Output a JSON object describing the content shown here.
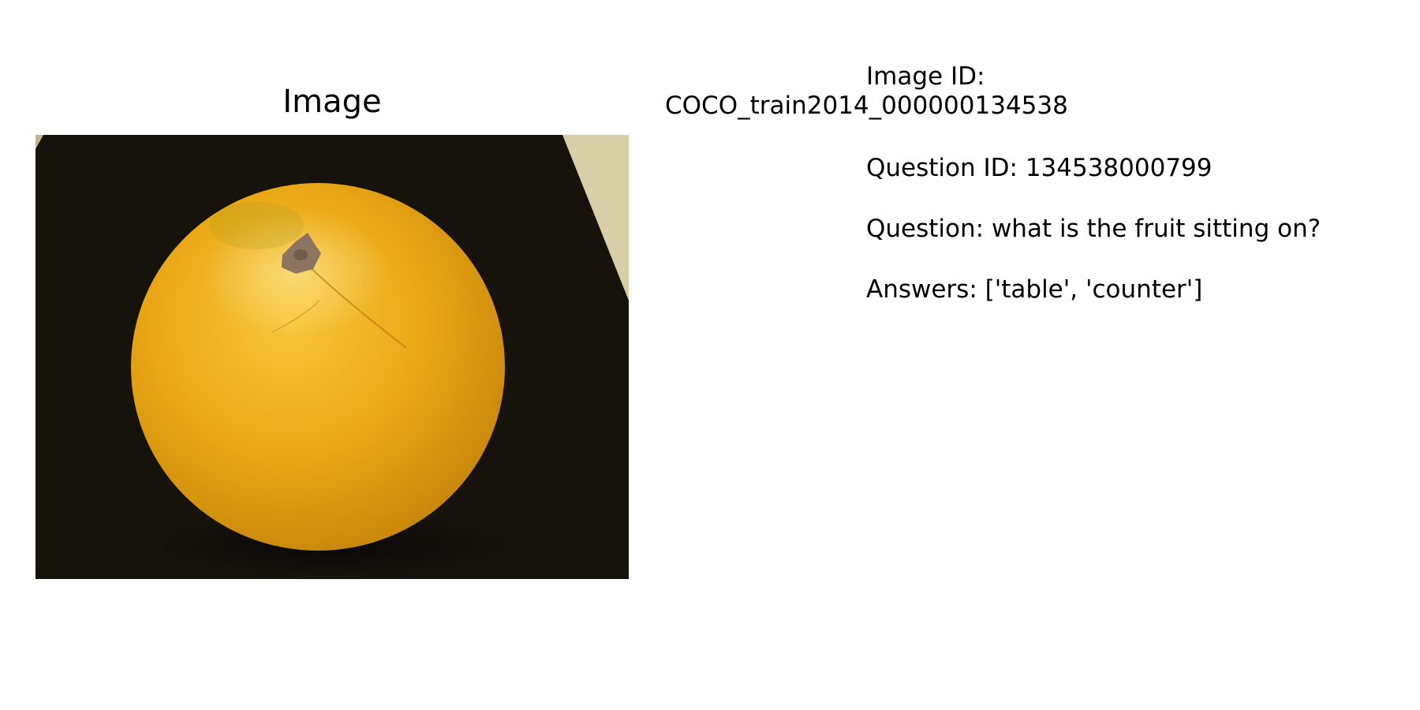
{
  "panel": {
    "title": "Image"
  },
  "info": {
    "image_id_label": "Image ID:",
    "image_id_value": "COCO_train2014_000000134538",
    "question_id_line": "Question ID: 134538000799",
    "question_line": "Question: what is the fruit sitting on?",
    "answers_line": "Answers: ['table', 'counter']"
  },
  "colors": {
    "background": "#ffffff",
    "text": "#000000",
    "surface": "#16130d",
    "fruit": "#e8a514",
    "fruit_shadow": "#c7860a",
    "fruit_highlight": "#f6c332",
    "stem": "#8b7560",
    "backdrop": "#d8cfa8"
  },
  "icons": {
    "photo": "orange-fruit-photo"
  }
}
